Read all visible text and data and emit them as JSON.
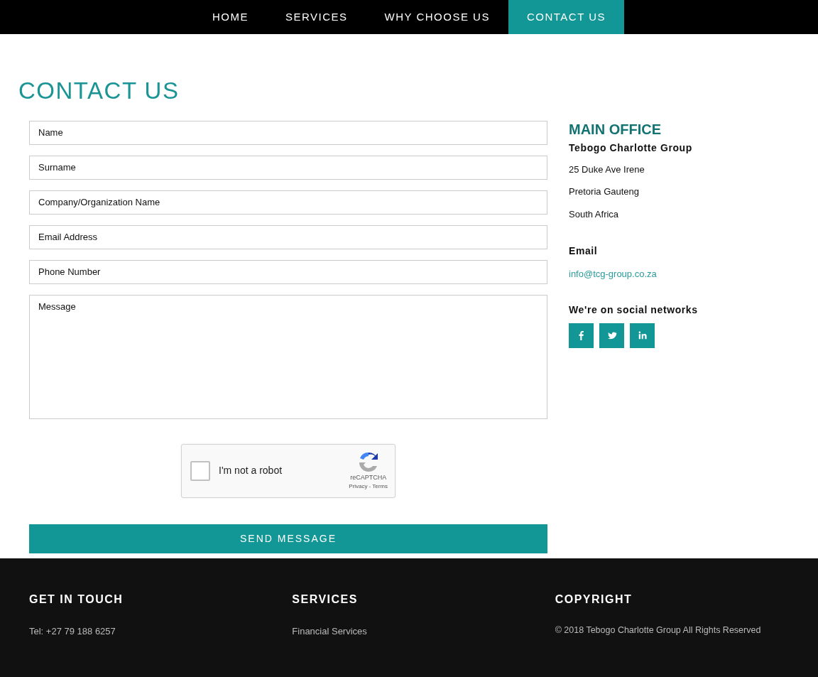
{
  "nav": [
    {
      "label": "HOME",
      "selected": false
    },
    {
      "label": "SERVICES",
      "selected": false
    },
    {
      "label": "WHY CHOOSE US",
      "selected": false
    },
    {
      "label": "CONTACT US",
      "selected": true
    }
  ],
  "title": "CONTACT US",
  "form": {
    "fields": [
      {
        "kind": "input",
        "placeholder": "Name"
      },
      {
        "kind": "input",
        "placeholder": "Surname"
      },
      {
        "kind": "input",
        "placeholder": "Company/Organization Name"
      },
      {
        "kind": "input",
        "placeholder": "Email Address"
      },
      {
        "kind": "input",
        "placeholder": "Phone Number"
      },
      {
        "kind": "textarea",
        "placeholder": "Message"
      }
    ],
    "captcha": {
      "label": "I'm not a robot",
      "checked": false,
      "brand": "reCAPTCHA",
      "links": [
        "Privacy",
        "Terms"
      ],
      "separator": "-"
    },
    "submit": "SEND MESSAGE"
  },
  "office": {
    "heading": "MAIN OFFICE",
    "company": "Tebogo Charlotte Group",
    "address": [
      "25 Duke Ave Irene",
      "Pretoria Gauteng",
      "South Africa"
    ],
    "email_label": "Email",
    "email": "info@tcg-group.co.za",
    "social_label": "We're on social networks",
    "social": [
      {
        "kind": "facebook"
      },
      {
        "kind": "twitter"
      },
      {
        "kind": "linkedin"
      }
    ]
  },
  "footer": [
    {
      "heading": "GET IN TOUCH",
      "text": "Tel: +27 79 188 6257"
    },
    {
      "heading": "SERVICES",
      "text": "Financial Services"
    },
    {
      "heading": "COPYRIGHT",
      "text": "© 2018 Tebogo Charlotte Group All Rights Reserved"
    }
  ]
}
